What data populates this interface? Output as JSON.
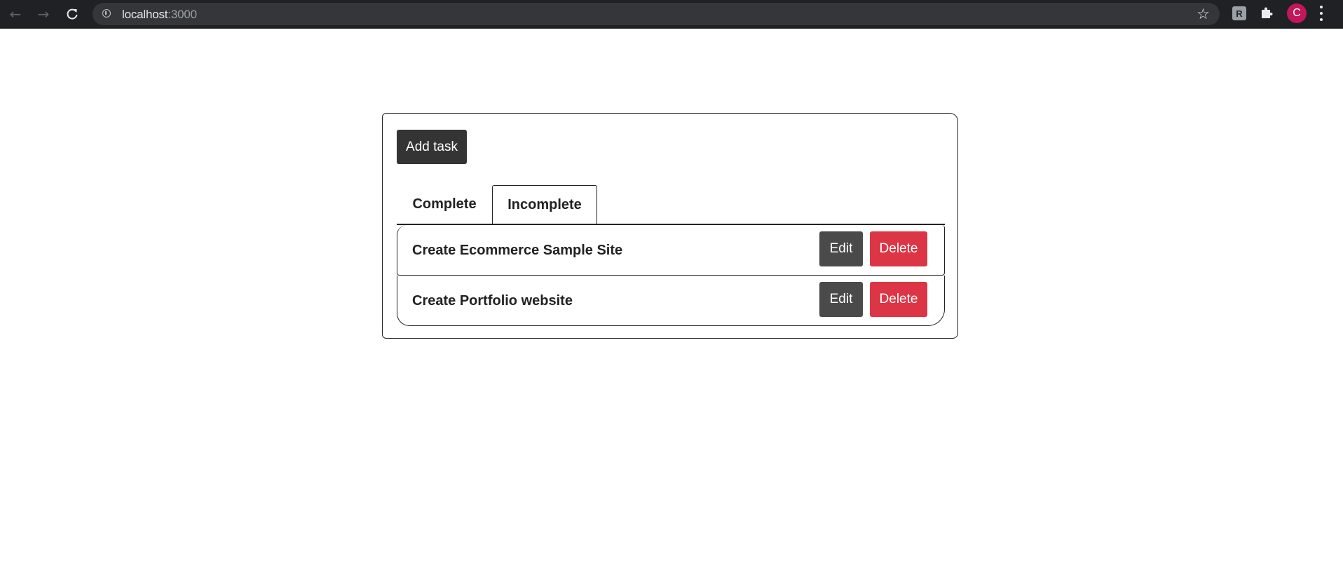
{
  "browser": {
    "url_host": "localhost",
    "url_port": ":3000",
    "profile_initial": "C",
    "extension_label": "R"
  },
  "app": {
    "add_task_label": "Add task",
    "tabs": [
      {
        "label": "Complete",
        "active": false
      },
      {
        "label": "Incomplete",
        "active": true
      }
    ],
    "tasks": [
      {
        "title": "Create Ecommerce Sample Site",
        "edit_label": "Edit",
        "delete_label": "Delete"
      },
      {
        "title": "Create Portfolio website",
        "edit_label": "Edit",
        "delete_label": "Delete"
      }
    ]
  },
  "colors": {
    "chrome_bg": "#202124",
    "button_dark": "#343434",
    "edit_button": "#4a4a4a",
    "delete_button": "#dc3545",
    "avatar": "#c2185b"
  }
}
